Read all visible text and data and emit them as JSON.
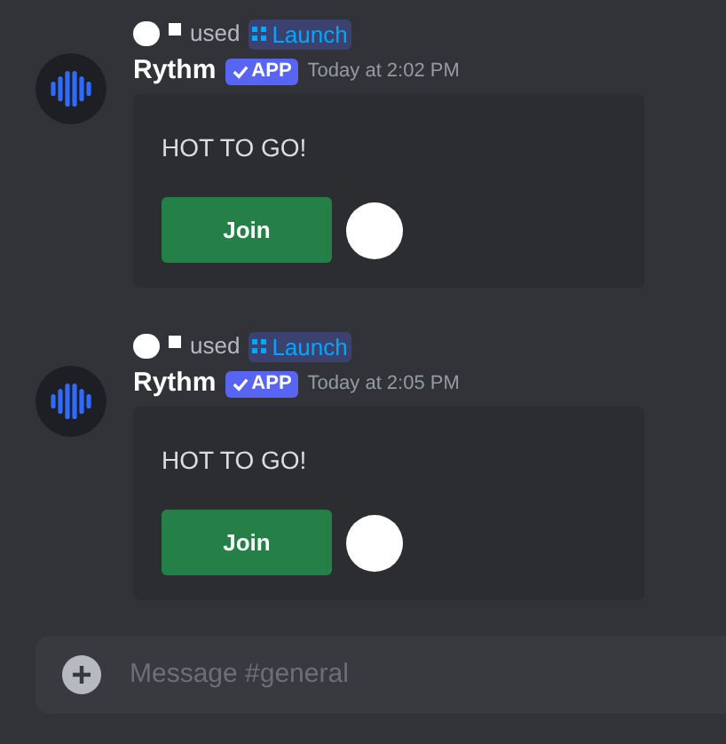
{
  "messages": [
    {
      "reply": {
        "used": "used",
        "command": "Launch"
      },
      "author": "Rythm",
      "badge": "APP",
      "timestamp": "Today at 2:02 PM",
      "embed": {
        "text": "HOT TO GO!",
        "button": "Join"
      }
    },
    {
      "reply": {
        "used": "used",
        "command": "Launch"
      },
      "author": "Rythm",
      "badge": "APP",
      "timestamp": "Today at 2:05 PM",
      "embed": {
        "text": "HOT TO GO!",
        "button": "Join"
      }
    }
  ],
  "composer": {
    "placeholder": "Message #general"
  }
}
